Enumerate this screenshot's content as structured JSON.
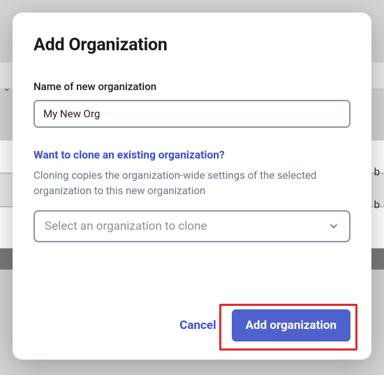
{
  "modal": {
    "title": "Add Organization",
    "name_label": "Name of new organization",
    "name_value": "My New Org",
    "clone_link": "Want to clone an existing organization?",
    "clone_description": "Cloning copies the organization-wide settings of the selected organization to this new organization",
    "clone_select_placeholder": "Select an organization to clone"
  },
  "footer": {
    "cancel_label": "Cancel",
    "submit_label": "Add organization"
  },
  "background": {
    "text1": "b",
    "text2": "b"
  },
  "colors": {
    "primary": "#4e61cd",
    "link": "#3a4fd6",
    "highlight": "#e22b2b"
  }
}
